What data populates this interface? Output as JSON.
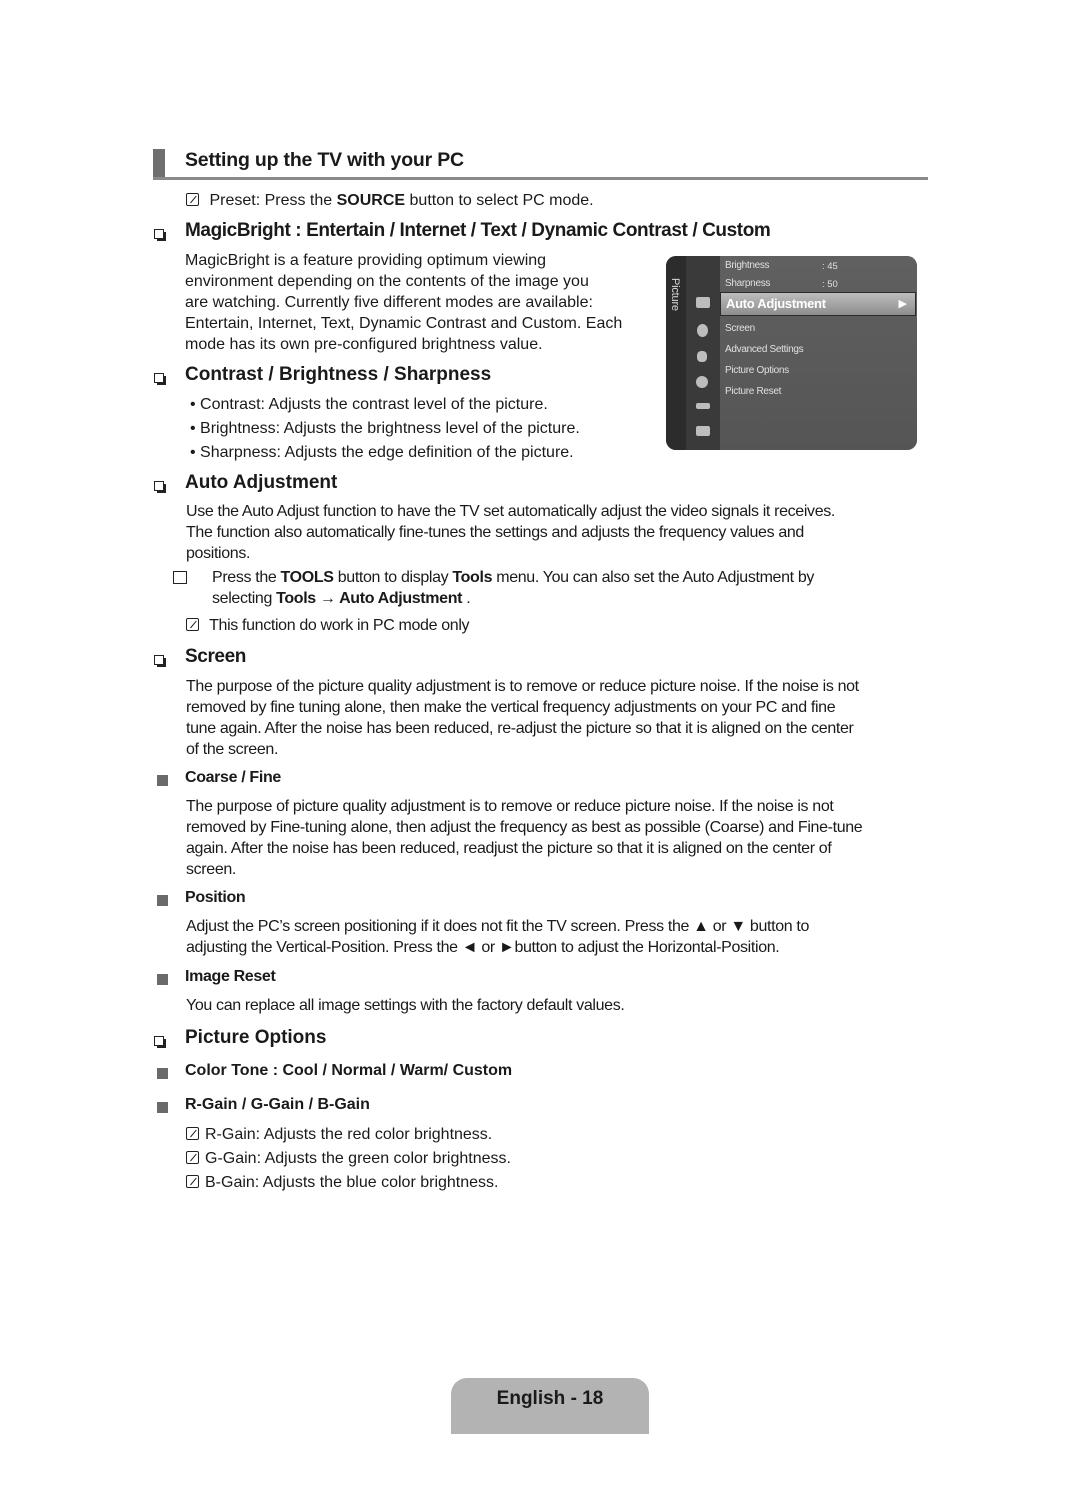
{
  "section": {
    "title": "Setting up the TV with your PC",
    "preset_note": {
      "prefix": "Preset: Press the ",
      "bold": "SOURCE",
      "suffix": " button to select PC mode."
    }
  },
  "magicbright": {
    "heading": "MagicBright : Entertain / Internet / Text / Dynamic Contrast / Custom",
    "lines": [
      "MagicBright is a feature providing optimum viewing",
      "environment depending on the contents of the image you",
      "are watching. Currently five different modes are available:",
      "Entertain, Internet, Text, Dynamic Contrast and Custom. Each",
      "mode has its own pre-configured brightness value."
    ]
  },
  "contrast": {
    "heading": "Contrast / Brightness / Sharpness",
    "bullets": [
      "Contrast: Adjusts the contrast level of the picture.",
      "Brightness: Adjusts the brightness level of the picture.",
      "Sharpness: Adjusts the edge definition of the picture."
    ]
  },
  "osd": {
    "side_label": "Picture",
    "items": [
      {
        "label": "Brightness",
        "value": ": 45"
      },
      {
        "label": "Sharpness",
        "value": ": 50"
      },
      {
        "label": "Screen"
      },
      {
        "label": "Advanced Settings"
      },
      {
        "label": "Picture Options"
      },
      {
        "label": "Picture Reset"
      }
    ],
    "selected": "Auto Adjustment",
    "selected_arrow": "▶"
  },
  "auto_adjustment": {
    "heading": "Auto Adjustment",
    "lines": [
      "Use the Auto Adjust function to have the TV set automatically adjust the video signals it receives.",
      "The function also automatically fine-tunes the settings and adjusts the frequency values and",
      "positions."
    ],
    "tools_note": {
      "l1_prefix": "Press the ",
      "l1_bold1": "TOOLS",
      "l1_mid": " button to display ",
      "l1_bold2": "Tools",
      "l1_suffix": " menu. You can also set the Auto Adjustment by",
      "l2_prefix": "selecting ",
      "l2_bold": "Tools → Auto Adjustment",
      "l2_suffix": " ."
    },
    "pc_note": "This function do work in PC mode only"
  },
  "screen": {
    "heading": "Screen",
    "lines": [
      "The purpose of the picture quality adjustment is to remove or reduce picture noise. If the noise is not",
      "removed by fine tuning alone, then make the vertical frequency adjustments on your PC and fine",
      "tune again. After the noise has been reduced, re-adjust the picture so that it is aligned on the center",
      "of the screen."
    ],
    "coarse_fine": {
      "heading": "Coarse / Fine",
      "lines": [
        "The purpose of picture quality adjustment is to remove or reduce picture noise. If the noise is not",
        "removed by Fine-tuning alone, then adjust the frequency as best as possible (Coarse) and Fine-tune",
        "again. After the noise has been reduced, readjust the picture so that it is aligned on the center of",
        "screen."
      ]
    },
    "position": {
      "heading": "Position",
      "lines": [
        "Adjust the PC’s screen positioning if it does not fit the TV screen. Press the ▲ or ▼ button to",
        "adjusting the Vertical-Position. Press the ◄ or ►button to adjust the Horizontal-Position."
      ]
    },
    "image_reset": {
      "heading": "Image Reset",
      "text": "You can replace all image settings with the factory default values."
    }
  },
  "picture_options": {
    "heading": "Picture Options",
    "color_tone": "Color Tone : Cool / Normal / Warm/ Custom",
    "gain_heading": "R-Gain / G-Gain / B-Gain",
    "gain_notes": [
      "R-Gain: Adjusts the red color brightness.",
      "G-Gain: Adjusts the green color brightness.",
      "B-Gain: Adjusts the blue color brightness."
    ]
  },
  "footer": {
    "page_label": "English - 18"
  }
}
